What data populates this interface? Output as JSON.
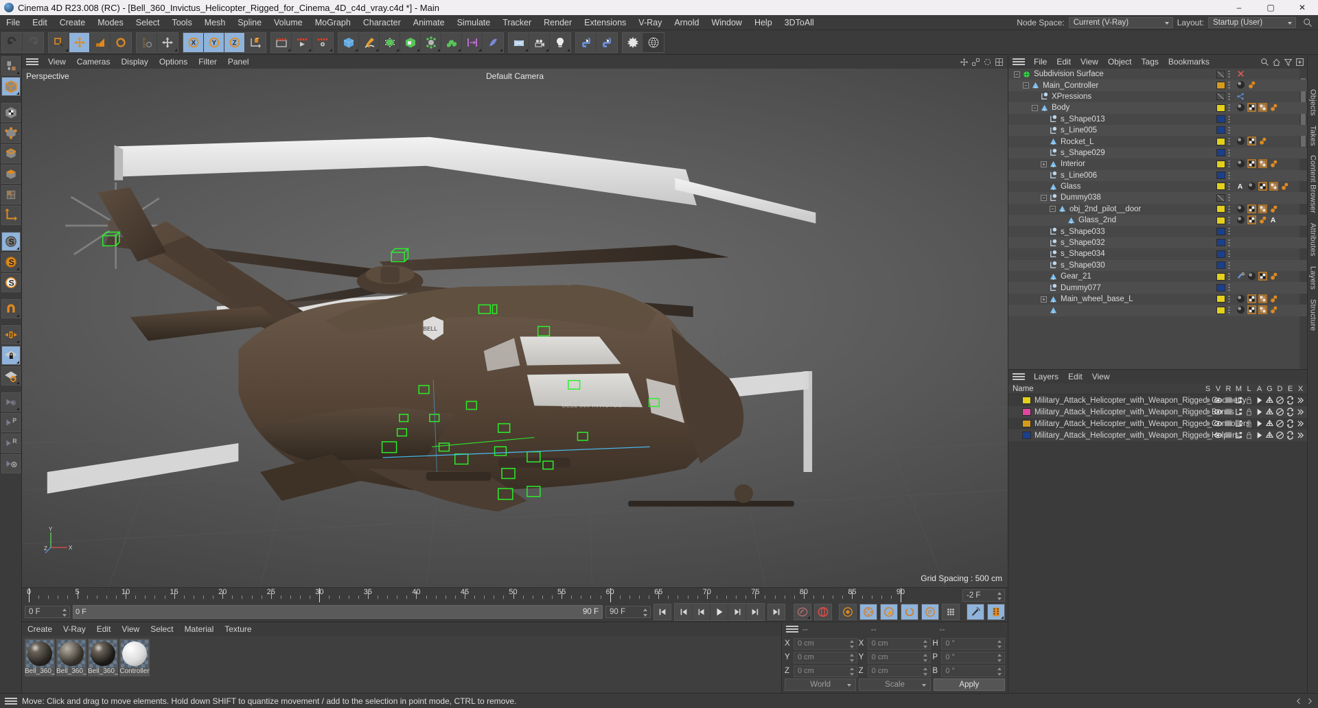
{
  "window": {
    "title": "Cinema 4D R23.008 (RC) - [Bell_360_Invictus_Helicopter_Rigged_for_Cinema_4D_c4d_vray.c4d *] - Main",
    "minimize": "–",
    "maximize": "▢",
    "close": "✕"
  },
  "menu": {
    "items": [
      "File",
      "Edit",
      "Create",
      "Modes",
      "Select",
      "Tools",
      "Mesh",
      "Spline",
      "Volume",
      "MoGraph",
      "Character",
      "Animate",
      "Simulate",
      "Tracker",
      "Render",
      "Extensions",
      "V-Ray",
      "Arnold",
      "Window",
      "Help",
      "3DToAll"
    ],
    "node_space_label": "Node Space:",
    "node_space_value": "Current (V-Ray)",
    "layout_label": "Layout:",
    "layout_value": "Startup (User)",
    "search_icon": "search-icon"
  },
  "toolbar": {
    "groups": [
      {
        "buttons": [
          {
            "name": "undo-button",
            "icon": "undo-icon",
            "active": false
          },
          {
            "name": "redo-button",
            "icon": "redo-icon",
            "active": false,
            "disabled": true
          }
        ]
      },
      {
        "buttons": [
          {
            "name": "live-selection-button",
            "icon": "selection-icon",
            "active": false,
            "corner": true
          },
          {
            "name": "move-tool-button",
            "icon": "move-icon",
            "active": true
          },
          {
            "name": "scale-tool-button",
            "icon": "scale-icon",
            "active": false
          },
          {
            "name": "rotate-tool-button",
            "icon": "rotate-icon",
            "active": false
          }
        ]
      },
      {
        "buttons": [
          {
            "name": "psr-reset-button",
            "icon": "psr-icon",
            "active": false
          },
          {
            "name": "world-move-button",
            "icon": "move-world-icon",
            "active": false,
            "corner": true
          }
        ]
      },
      {
        "buttons": [
          {
            "name": "axis-x-lock-button",
            "icon": "x-axis-icon",
            "active": true
          },
          {
            "name": "axis-y-lock-button",
            "icon": "y-axis-icon",
            "active": true
          },
          {
            "name": "axis-z-lock-button",
            "icon": "z-axis-icon",
            "active": true
          },
          {
            "name": "world-object-axis-button",
            "icon": "world-axis-icon",
            "active": false
          }
        ]
      },
      {
        "buttons": [
          {
            "name": "render-view-button",
            "icon": "render-view-icon",
            "active": false,
            "corner": true
          },
          {
            "name": "render-to-picture-viewer-button",
            "icon": "render-picture-icon",
            "active": false,
            "corner": true
          },
          {
            "name": "render-settings-button",
            "icon": "render-settings-icon",
            "active": false,
            "corner": true
          }
        ]
      },
      {
        "buttons": [
          {
            "name": "add-cube-button",
            "icon": "cube-icon",
            "active": false,
            "corner": true
          },
          {
            "name": "add-spline-button",
            "icon": "pen-spline-icon",
            "active": false,
            "corner": true
          },
          {
            "name": "nurbs-generator-button",
            "icon": "nurbs-icon",
            "active": false,
            "corner": true
          },
          {
            "name": "array-generator-button",
            "icon": "array-icon",
            "active": false,
            "corner": true
          },
          {
            "name": "deformer-button",
            "icon": "deformer-icon",
            "active": false,
            "corner": true
          },
          {
            "name": "mograph-cloner-button",
            "icon": "cloner-icon",
            "active": false,
            "corner": true
          },
          {
            "name": "scene-helper-button",
            "icon": "helper-icon",
            "active": false,
            "corner": true
          },
          {
            "name": "field-button",
            "icon": "field-icon",
            "active": false,
            "corner": true
          }
        ]
      },
      {
        "buttons": [
          {
            "name": "floor-environment-button",
            "icon": "floor-icon",
            "active": false,
            "corner": true
          },
          {
            "name": "camera-button",
            "icon": "camera-icon",
            "active": false,
            "corner": true
          },
          {
            "name": "light-button",
            "icon": "light-icon",
            "active": false,
            "corner": true
          }
        ]
      },
      {
        "buttons": [
          {
            "name": "python-tag-button",
            "icon": "python-icon",
            "active": false
          },
          {
            "name": "python-generator-button",
            "icon": "python-icon",
            "active": false
          }
        ]
      },
      {
        "buttons": [
          {
            "name": "noise-button",
            "icon": "burst-icon",
            "active": false
          },
          {
            "name": "globe-button",
            "icon": "globe-icon",
            "active": false
          }
        ]
      }
    ]
  },
  "rail": {
    "buttons": [
      {
        "name": "make-editable-button",
        "icon": "make-editable-icon",
        "active": false,
        "corner": true
      },
      {
        "name": "model-mode-button",
        "icon": "model-mode-icon",
        "active": true,
        "corner": true
      },
      {
        "name": "texture-mode-button",
        "icon": "texture-mode-icon",
        "active": false
      },
      {
        "name": "points-mode-button",
        "icon": "points-mode-icon",
        "active": false
      },
      {
        "name": "edges-mode-button",
        "icon": "edges-mode-icon",
        "active": false
      },
      {
        "name": "polygons-mode-button",
        "icon": "polygons-mode-icon",
        "active": false
      },
      {
        "name": "uv-mode-button",
        "icon": "uv-mode-icon",
        "active": false
      },
      {
        "name": "axis-mode-button",
        "icon": "axis-mode-icon",
        "active": false
      },
      {
        "name": "snap-enable-button",
        "icon": "snap-s-grey-icon",
        "active": true,
        "corner": true
      },
      {
        "name": "snap-quantize-button",
        "icon": "snap-s-orange-icon",
        "active": false,
        "corner": true
      },
      {
        "name": "snap-settings-button",
        "icon": "snap-s-white-icon",
        "active": false
      },
      {
        "name": "magnet-button",
        "icon": "magnet-icon",
        "active": false,
        "corner": true
      },
      {
        "name": "workplane-button",
        "icon": "workplane-icon",
        "active": false,
        "corner": true
      },
      {
        "name": "lock-workplane-button",
        "icon": "workplane-lock-icon",
        "active": true,
        "corner": true
      },
      {
        "name": "align-workplane-button",
        "icon": "workplane-align-icon",
        "active": false,
        "corner": true
      },
      {
        "name": "joint-tool-button",
        "icon": "joint-icon",
        "active": false,
        "corner": true
      },
      {
        "name": "joint-p-button",
        "icon": "joint-p-icon",
        "active": false
      },
      {
        "name": "joint-r-button",
        "icon": "joint-r-icon",
        "active": false
      },
      {
        "name": "weight-tool-button",
        "icon": "weight-icon",
        "active": false
      }
    ]
  },
  "viewport": {
    "menu": [
      "View",
      "Cameras",
      "Display",
      "Options",
      "Filter",
      "Panel"
    ],
    "label": "Perspective",
    "camera": "Default Camera",
    "grid_spacing": "Grid Spacing : 500 cm",
    "axis_x": "X",
    "axis_y": "Y",
    "axis_z": "Z",
    "corner_icons": [
      "move-viewport-icon",
      "scale-viewport-icon",
      "rotate-viewport-icon",
      "maximize-viewport-icon"
    ]
  },
  "timeline": {
    "ticks": [
      {
        "label": "0",
        "frame": 0
      },
      {
        "label": "5",
        "frame": 5
      },
      {
        "label": "10",
        "frame": 10
      },
      {
        "label": "15",
        "frame": 15
      },
      {
        "label": "20",
        "frame": 20
      },
      {
        "label": "25",
        "frame": 25
      },
      {
        "label": "30",
        "frame": 30
      },
      {
        "label": "35",
        "frame": 35
      },
      {
        "label": "40",
        "frame": 40
      },
      {
        "label": "45",
        "frame": 45
      },
      {
        "label": "50",
        "frame": 50
      },
      {
        "label": "55",
        "frame": 55
      },
      {
        "label": "60",
        "frame": 60
      },
      {
        "label": "65",
        "frame": 65
      },
      {
        "label": "70",
        "frame": 70
      },
      {
        "label": "75",
        "frame": 75
      },
      {
        "label": "80",
        "frame": 80
      },
      {
        "label": "85",
        "frame": 85
      },
      {
        "label": "90",
        "frame": 90
      }
    ],
    "range_end_field": "-2 F",
    "current_frame_field": "0 F",
    "track_start": "0 F",
    "track_end": "90 F",
    "max_frame_field": "90 F",
    "transport": [
      {
        "name": "go-to-start-button",
        "icon": "skip-start-icon"
      },
      {
        "name": "previous-keyframe-button",
        "icon": "prev-key-icon"
      },
      {
        "name": "step-back-button",
        "icon": "step-back-icon"
      },
      {
        "name": "play-button",
        "icon": "play-icon"
      },
      {
        "name": "step-forward-button",
        "icon": "step-forward-icon"
      },
      {
        "name": "next-keyframe-button",
        "icon": "next-key-icon"
      },
      {
        "name": "go-to-end-button",
        "icon": "skip-end-icon"
      }
    ],
    "record_buttons": [
      {
        "name": "record-active-objects-button",
        "icon": "key-record-icon",
        "active": false
      },
      {
        "name": "autokeying-button",
        "icon": "autokey-icon",
        "active": false
      },
      {
        "name": "keyframe-selection-button",
        "icon": "key-select-icon",
        "active": false
      },
      {
        "name": "position-key-button",
        "icon": "position-key-icon",
        "active": true
      },
      {
        "name": "scale-key-button",
        "icon": "scale-key-icon",
        "active": true
      },
      {
        "name": "rotation-key-button",
        "icon": "rotation-key-icon",
        "active": true
      },
      {
        "name": "parameter-key-button",
        "icon": "param-key-icon",
        "active": true
      },
      {
        "name": "point-level-animation-button",
        "icon": "pla-icon",
        "active": false
      },
      {
        "name": "animation-mode-button",
        "icon": "anim-mode-icon",
        "active": true
      },
      {
        "name": "filmstrip-button",
        "icon": "filmstrip-icon",
        "active": true
      }
    ]
  },
  "material_manager": {
    "menu": [
      "Create",
      "V-Ray",
      "Edit",
      "View",
      "Select",
      "Material",
      "Texture"
    ],
    "materials": [
      {
        "name": "Bell_360_",
        "color": "#2a2724",
        "type": "glossy-dark"
      },
      {
        "name": "Bell_360_",
        "color": "#3a352f",
        "type": "striped"
      },
      {
        "name": "Bell_360_",
        "color": "#1e1c1a",
        "type": "glass"
      },
      {
        "name": "Controller",
        "color": "#dcdcdc",
        "type": "matte-white"
      }
    ]
  },
  "coordinates": {
    "header": [
      "--",
      "--",
      "--"
    ],
    "rows": [
      {
        "label": "X",
        "pos": "0 cm",
        "size": "0 cm",
        "rot_label": "H",
        "rot": "0 °"
      },
      {
        "label": "Y",
        "pos": "0 cm",
        "size": "0 cm",
        "rot_label": "P",
        "rot": "0 °"
      },
      {
        "label": "Z",
        "pos": "0 cm",
        "size": "0 cm",
        "rot_label": "B",
        "rot": "0 °"
      }
    ],
    "space_select": "World",
    "mode_select": "Scale",
    "apply_label": "Apply"
  },
  "object_manager": {
    "menu": [
      "File",
      "Edit",
      "View",
      "Object",
      "Tags",
      "Bookmarks"
    ],
    "tools": [
      "search-icon",
      "home-icon",
      "filter-icon",
      "add-icon"
    ],
    "items": [
      {
        "name": "Subdivision Surface",
        "depth": 0,
        "expander": "−",
        "icon": "subdivision-icon",
        "color": "none",
        "tags": [
          "close-x-icon"
        ]
      },
      {
        "name": "Main_Controller",
        "depth": 1,
        "expander": "−",
        "icon": "null-object-icon",
        "color": "#d59b1a",
        "tags": [
          "material-icon",
          "vertexmap-icon"
        ]
      },
      {
        "name": "XPressions",
        "depth": 2,
        "expander": "",
        "icon": "polygon-object-icon",
        "color": "none",
        "tags": [
          "xpresso-icon"
        ]
      },
      {
        "name": "Body",
        "depth": 2,
        "expander": "−",
        "icon": "null-object-icon",
        "color": "#e3d01c",
        "tags": [
          "material-icon",
          "uv-icon",
          "texture-icon",
          "vertexmap-icon"
        ]
      },
      {
        "name": "s_Shape013",
        "depth": 3,
        "expander": "",
        "icon": "polygon-object-icon",
        "color": "#1b3f8b",
        "tags": []
      },
      {
        "name": "s_Line005",
        "depth": 3,
        "expander": "",
        "icon": "polygon-object-icon",
        "color": "#1b3f8b",
        "tags": []
      },
      {
        "name": "Rocket_L",
        "depth": 3,
        "expander": "",
        "icon": "null-object-icon",
        "color": "#e3d01c",
        "tags": [
          "material-icon",
          "uv-icon",
          "vertexmap-icon"
        ]
      },
      {
        "name": "s_Shape029",
        "depth": 3,
        "expander": "",
        "icon": "polygon-object-icon",
        "color": "#1b3f8b",
        "tags": []
      },
      {
        "name": "Interior",
        "depth": 3,
        "expander": "+",
        "icon": "null-object-icon",
        "color": "#e3d01c",
        "tags": [
          "material-icon",
          "uv-icon",
          "texture-icon",
          "vertexmap-icon"
        ]
      },
      {
        "name": "s_Line006",
        "depth": 3,
        "expander": "",
        "icon": "polygon-object-icon",
        "color": "#1b3f8b",
        "tags": []
      },
      {
        "name": "Glass",
        "depth": 3,
        "expander": "",
        "icon": "null-object-icon",
        "color": "#e3d01c",
        "tags": [
          "letter-a-icon",
          "material-icon",
          "uv-icon",
          "texture-icon",
          "vertexmap-icon"
        ]
      },
      {
        "name": "Dummy038",
        "depth": 3,
        "expander": "−",
        "icon": "polygon-object-icon",
        "color": "none",
        "tags": []
      },
      {
        "name": "obj_2nd_pilot__door",
        "depth": 4,
        "expander": "−",
        "icon": "null-object-icon",
        "color": "#e3d01c",
        "tags": [
          "material-icon",
          "uv-icon",
          "texture-icon",
          "vertexmap-icon"
        ]
      },
      {
        "name": "Glass_2nd",
        "depth": 5,
        "expander": "",
        "icon": "null-object-icon",
        "color": "#e3d01c",
        "tags": [
          "material-icon",
          "uv-icon",
          "vertexmap-icon",
          "letter-a-icon"
        ]
      },
      {
        "name": "s_Shape033",
        "depth": 3,
        "expander": "",
        "icon": "polygon-object-icon",
        "color": "#1b3f8b",
        "tags": []
      },
      {
        "name": "s_Shape032",
        "depth": 3,
        "expander": "",
        "icon": "polygon-object-icon",
        "color": "#1b3f8b",
        "tags": []
      },
      {
        "name": "s_Shape034",
        "depth": 3,
        "expander": "",
        "icon": "polygon-object-icon",
        "color": "#1b3f8b",
        "tags": []
      },
      {
        "name": "s_Shape030",
        "depth": 3,
        "expander": "",
        "icon": "polygon-object-icon",
        "color": "#1b3f8b",
        "tags": []
      },
      {
        "name": "Gear_21",
        "depth": 3,
        "expander": "",
        "icon": "null-object-icon",
        "color": "#e3d01c",
        "tags": [
          "constraint-icon",
          "material-icon",
          "uv-icon",
          "vertexmap-icon"
        ]
      },
      {
        "name": "Dummy077",
        "depth": 3,
        "expander": "",
        "icon": "polygon-object-icon",
        "color": "#1b3f8b",
        "tags": []
      },
      {
        "name": "Main_wheel_base_L",
        "depth": 3,
        "expander": "+",
        "icon": "null-object-icon",
        "color": "#e3d01c",
        "tags": [
          "material-icon",
          "uv-icon",
          "texture-icon",
          "vertexmap-icon"
        ]
      },
      {
        "name": "",
        "depth": 3,
        "expander": "",
        "icon": "null-object-icon",
        "color": "#e3d01c",
        "tags": [
          "material-icon",
          "uv-icon",
          "texture-icon",
          "vertexmap-icon"
        ]
      }
    ]
  },
  "layer_manager": {
    "menu": [
      "Layers",
      "Edit",
      "View"
    ],
    "name_column": "Name",
    "columns": [
      "S",
      "V",
      "R",
      "M",
      "L",
      "A",
      "G",
      "D",
      "E",
      "X"
    ],
    "rows": [
      {
        "name": "Military_Attack_Helicopter_with_Weapon_Rigged_Geometry",
        "color": "#e3d01c"
      },
      {
        "name": "Military_Attack_Helicopter_with_Weapon_Rigged_Bones",
        "color": "#e0479e"
      },
      {
        "name": "Military_Attack_Helicopter_with_Weapon_Rigged_Controllers",
        "color": "#d59b1a"
      },
      {
        "name": "Military_Attack_Helicopter_with_Weapon_Rigged_Helpers",
        "color": "#1b3f8b"
      }
    ]
  },
  "right_tabs": [
    "Objects",
    "Takes",
    "Content Browser",
    "Attributes",
    "Layers",
    "Structure"
  ],
  "status": {
    "message": "Move: Click and drag to move elements. Hold down SHIFT to quantize movement / add to the selection in point mode, CTRL to remove."
  },
  "colors": {
    "accent_blue": "#8fb3da",
    "orange": "#e08a1e",
    "panel_bg": "#3b3b3b",
    "list_bg": "#474747",
    "text": "#d4d4d4"
  }
}
